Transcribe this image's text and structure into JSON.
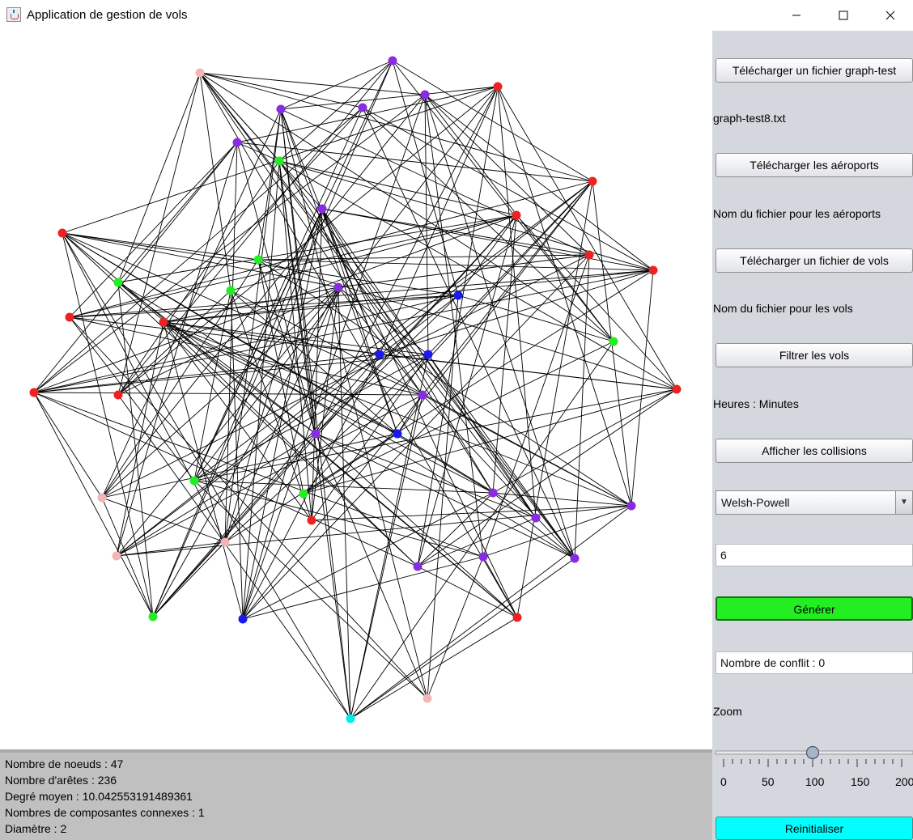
{
  "window": {
    "title": "Application de gestion de vols"
  },
  "sidebar": {
    "upload_graph_label": "Télécharger un fichier graph-test",
    "graph_file": "graph-test8.txt",
    "upload_airports_label": "Télécharger les aéroports",
    "airports_file": "Nom du fichier pour les aéroports",
    "upload_flights_label": "Télécharger un fichier de vols",
    "flights_file": "Nom du fichier pour les vols",
    "filter_label": "Filtrer les vols",
    "time_label": "Heures : Minutes",
    "collisions_label": "Afficher les collisions",
    "algorithm": "Welsh-Powell",
    "k_value": "6",
    "generate_label": "Générer",
    "conflicts": "Nombre de conflit : 0",
    "zoom_label": "Zoom",
    "zoom_value": 100,
    "zoom_ticks": [
      "0",
      "50",
      "100",
      "150",
      "200"
    ],
    "reset_label": "Reinitialiser"
  },
  "stats": {
    "nodes": "Nombre de noeuds : 47",
    "edges": "Nombre d'arêtes : 236",
    "avg_degree": "Degré moyen : 10.042553191489361",
    "components": "Nombres de composantes connexes : 1",
    "diameter": "Diamètre : 2"
  },
  "colors": {
    "red": "#ee2222",
    "purple": "#8a2be2",
    "green": "#22ee22",
    "blue": "#1a1aee",
    "pink": "#f5b5b5",
    "cyan": "#00eeee",
    "generate_btn": "#22ee22",
    "reset_btn": "#00ffff"
  }
}
